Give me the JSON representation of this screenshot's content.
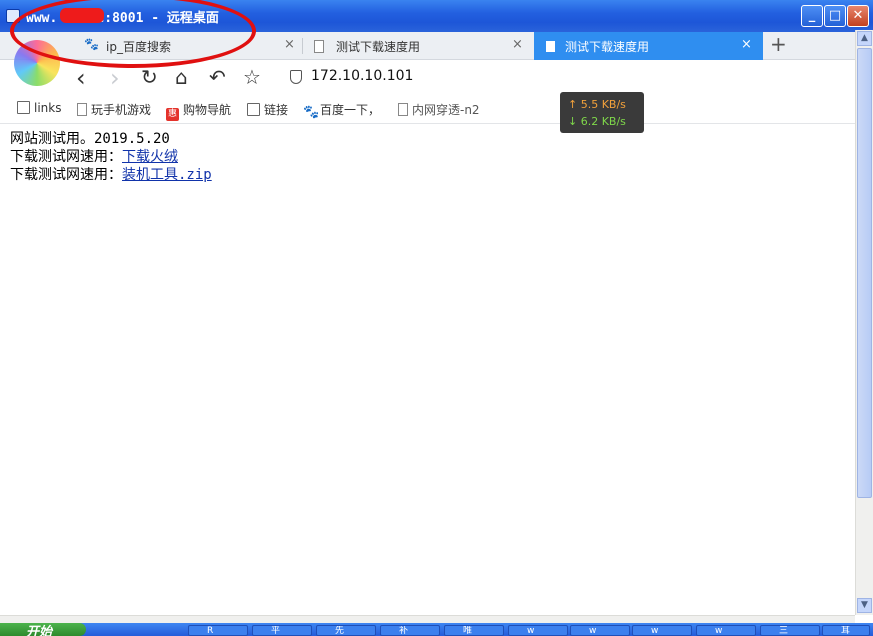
{
  "window": {
    "title": "www.     c:8001 - 远程桌面",
    "minimize_label": "_",
    "maximize_label": "□",
    "close_label": "✕"
  },
  "tabs": [
    {
      "label": "ip_百度搜索",
      "icon": "baidu-paw-icon",
      "close": "×"
    },
    {
      "label": "测试下载速度用",
      "icon": "page-icon",
      "close": "×"
    },
    {
      "label": "测试下载速度用",
      "icon": "page-icon",
      "close": "×",
      "active": true
    }
  ],
  "new_tab_label": "+",
  "nav": {
    "back": "‹",
    "forward": "›",
    "reload": "↻",
    "home": "⌂",
    "undo": "↶",
    "favorite": "☆",
    "url": "172.10.10.101"
  },
  "bookmarks": [
    {
      "label": "links",
      "icon": "folder-icon"
    },
    {
      "label": "玩手机游戏",
      "icon": "page-icon"
    },
    {
      "label": "购物导航",
      "icon": "hui-icon",
      "badge": "惠"
    },
    {
      "label": "链接",
      "icon": "folder-icon"
    },
    {
      "label": "百度一下，",
      "icon": "baidu-paw-icon"
    },
    {
      "label": "内网穿透-n2",
      "icon": "page-icon"
    }
  ],
  "speed": {
    "up": "↑ 5.5 KB/s",
    "down": "↓ 6.2 KB/s"
  },
  "content": {
    "line1": "网站测试用。2019.5.20",
    "line2_prefix": "下载测试网速用：",
    "line2_link": "下载火绒",
    "line3_prefix": "下载测试网速用：",
    "line3_link": "装机工具.zip"
  },
  "taskbar": {
    "start_label": "开始",
    "items": [
      "R",
      "平",
      "先",
      "补",
      "唯",
      "w",
      "w",
      "w",
      "w",
      "三",
      "耳"
    ]
  },
  "colors": {
    "title_bar": "#2360e0",
    "active_tab": "#2f8ef0",
    "link": "#1133aa",
    "annotation_circle": "#e01010",
    "speed_up": "#f2a13b",
    "speed_down": "#7fd74a"
  }
}
